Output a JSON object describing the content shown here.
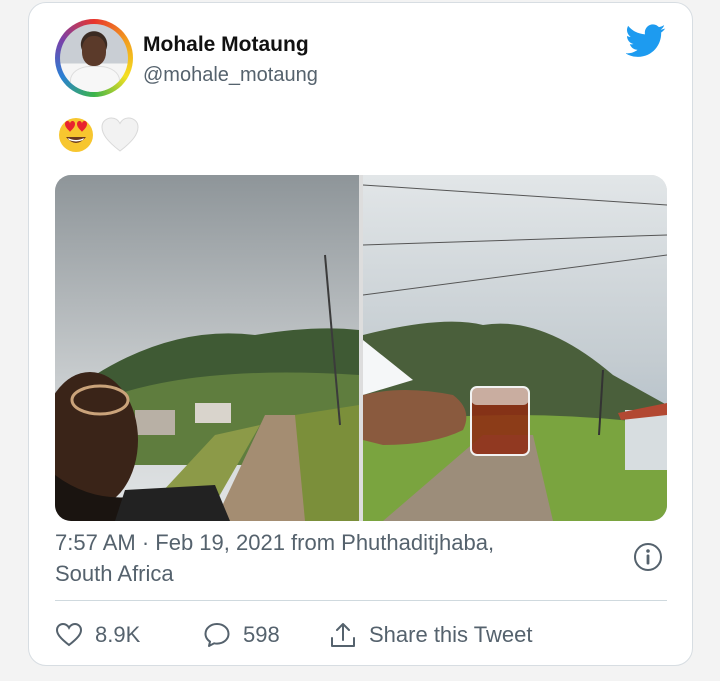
{
  "tweet": {
    "author_name": "Mohale Motaung",
    "author_handle": "@mohale_motaung",
    "body_emojis": [
      "smiling-face-with-heart-eyes",
      "white-heart"
    ],
    "timestamp_line1": "7:57 AM · Feb 19, 2021 from Phuthaditjhaba,",
    "timestamp_line2": "South Africa",
    "actions": {
      "like_count": "8.9K",
      "reply_count": "598",
      "share_label": "Share this Tweet"
    }
  },
  "icons": {
    "brand": "twitter-bird-icon",
    "info": "info-icon",
    "like": "heart-outline-icon",
    "reply": "speech-bubble-icon",
    "share": "share-upload-icon"
  },
  "colors": {
    "twitter_blue": "#1d9bf0",
    "secondary_text": "#55626d",
    "divider": "#cfd9de"
  }
}
